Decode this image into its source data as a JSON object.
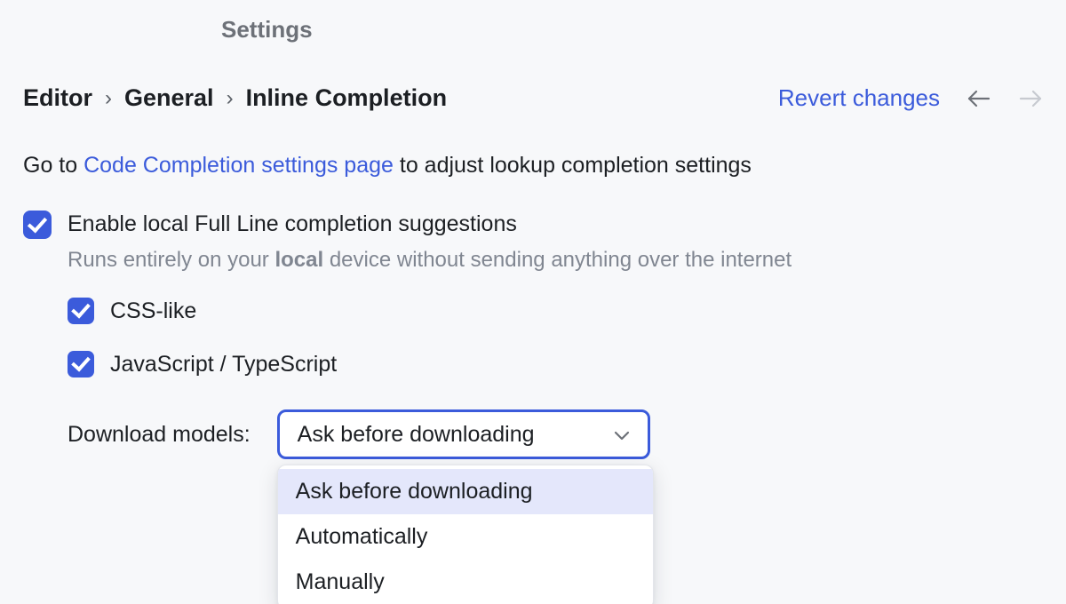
{
  "title": "Settings",
  "breadcrumb": {
    "items": [
      "Editor",
      "General",
      "Inline Completion"
    ],
    "sep": "›"
  },
  "revert_label": "Revert changes",
  "info": {
    "prefix": "Go to ",
    "link": "Code Completion settings page",
    "suffix": " to adjust lookup completion settings"
  },
  "enable": {
    "label": "Enable local Full Line completion suggestions",
    "desc_pre": "Runs entirely on your ",
    "desc_bold": "local",
    "desc_post": " device without sending anything over the internet"
  },
  "langs": {
    "css": "CSS-like",
    "jsts": "JavaScript / TypeScript"
  },
  "download": {
    "label": "Download models:",
    "selected": "Ask before downloading",
    "options": [
      "Ask before downloading",
      "Automatically",
      "Manually"
    ]
  }
}
